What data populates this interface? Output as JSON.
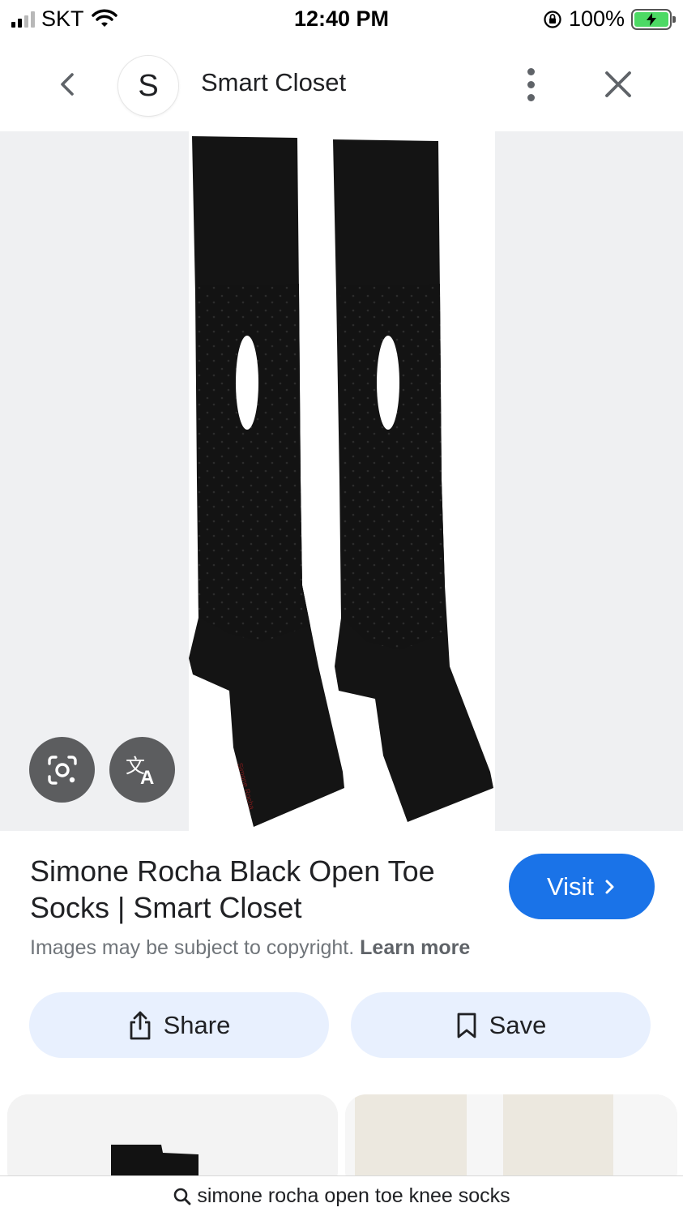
{
  "status_bar": {
    "carrier": "SKT",
    "time": "12:40 PM",
    "battery": "100%"
  },
  "header": {
    "site_initial": "S",
    "site_name": "Smart Closet"
  },
  "result": {
    "title": "Simone Rocha Black Open Toe Socks | Smart Closet",
    "visit_label": "Visit",
    "copyright_text": "Images may be subject to copyright.",
    "learn_more": "Learn more"
  },
  "actions": {
    "share_label": "Share",
    "save_label": "Save"
  },
  "search": {
    "query": "simone rocha open toe knee socks"
  },
  "colors": {
    "accent": "#1a73e8",
    "action_bg": "#e8f0fe",
    "overlay_button": "#5c5d5f",
    "image_backdrop": "#eff0f2"
  },
  "icons": [
    "chevron-left-icon",
    "more-vert-icon",
    "close-icon",
    "lens-icon",
    "translate-icon",
    "chevron-right-icon",
    "share-icon",
    "bookmark-icon",
    "search-icon",
    "wifi-icon",
    "signal-icon",
    "battery-icon",
    "orientation-lock-icon"
  ]
}
